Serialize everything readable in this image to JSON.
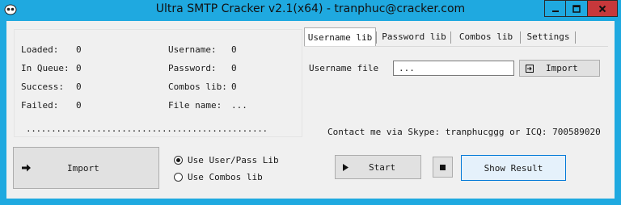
{
  "window": {
    "title": "Ultra SMTP Cracker v2.1(x64) - tranphuc@cracker.com",
    "accent": "#1fa9e0",
    "close_color": "#c7383b"
  },
  "stats": {
    "loaded_label": "Loaded:",
    "loaded_value": "0",
    "queue_label": "In Queue:",
    "queue_value": "0",
    "success_label": "Success:",
    "success_value": "0",
    "failed_label": "Failed:",
    "failed_value": "0",
    "username_label": "Username:",
    "username_value": "0",
    "password_label": "Password:",
    "password_value": "0",
    "combos_label": "Combos lib:",
    "combos_value": "0",
    "filename_label": "File name:",
    "filename_value": "...",
    "progress_dots": "................................................"
  },
  "tabs": [
    {
      "label": "Username lib",
      "active": true
    },
    {
      "label": "Password lib",
      "active": false
    },
    {
      "label": "Combos lib",
      "active": false
    },
    {
      "label": "Settings",
      "active": false
    }
  ],
  "username_tab": {
    "file_label": "Username file",
    "file_value": "...",
    "import_label": "Import"
  },
  "contact": "Contact me via Skype: tranphucggg or ICQ: 700589020",
  "bottom": {
    "import_label": "Import",
    "radio_userpass": "Use User/Pass Lib",
    "radio_combos": "Use Combos lib",
    "start_label": "Start",
    "show_result_label": "Show Result"
  }
}
